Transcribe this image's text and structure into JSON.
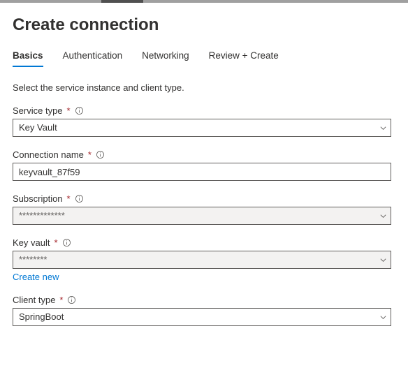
{
  "header": {
    "title": "Create connection"
  },
  "tabs": [
    {
      "label": "Basics",
      "active": true
    },
    {
      "label": "Authentication",
      "active": false
    },
    {
      "label": "Networking",
      "active": false
    },
    {
      "label": "Review + Create",
      "active": false
    }
  ],
  "instruction": "Select the service instance and client type.",
  "fields": {
    "service_type": {
      "label": "Service type",
      "required": "*",
      "value": "Key Vault"
    },
    "connection_name": {
      "label": "Connection name",
      "required": "*",
      "value": "keyvault_87f59"
    },
    "subscription": {
      "label": "Subscription",
      "required": "*",
      "value": "*************"
    },
    "key_vault": {
      "label": "Key vault",
      "required": "*",
      "value": "********",
      "create_new": "Create new"
    },
    "client_type": {
      "label": "Client type",
      "required": "*",
      "value": "SpringBoot"
    }
  }
}
